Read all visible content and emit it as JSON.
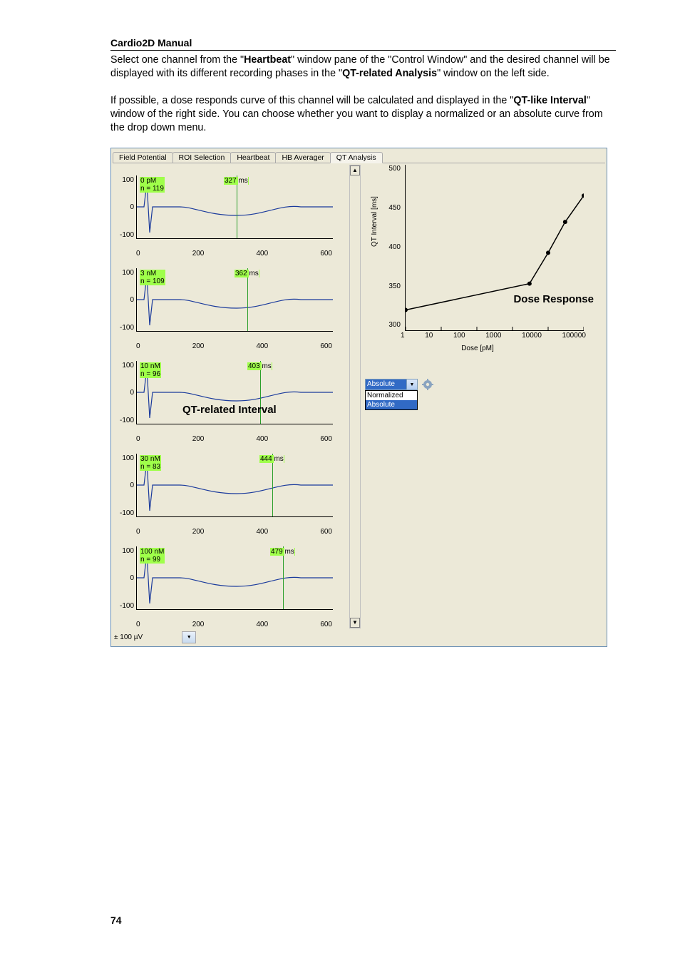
{
  "header": {
    "title": "Cardio2D Manual"
  },
  "para1": {
    "t1": "Select one channel from the \"",
    "heartbeat": "Heartbeat",
    "t2": "\" window pane of the \"Control Window\" and the desired channel will be displayed with its different recording phases in the \"",
    "qtrel": "QT-related Analysis",
    "t3": "\" window on the left side."
  },
  "para2": {
    "t1": "If possible, a dose responds curve of this channel will be calculated and displayed in the \"",
    "qtlike": "QT-like Interval",
    "t2": "\" window of the right side. You can choose whether you want to display a normalized or an absolute curve from the drop down menu."
  },
  "tabs": [
    "Field Potential",
    "ROI Selection",
    "Heartbeat",
    "HB Averager",
    "QT Analysis"
  ],
  "active_tab": 4,
  "yticks": [
    "100",
    "0",
    "-100"
  ],
  "xticks": [
    "0",
    "200",
    "400",
    "600"
  ],
  "unitbar": {
    "label": "± 100 µV"
  },
  "overlay_left": "QT-related Interval",
  "chart_data": {
    "left_panels": [
      {
        "dose": "0 pM",
        "n": "n = 119",
        "ms": 327,
        "ms_x_frac": 0.51
      },
      {
        "dose": "3 nM",
        "n": "n = 109",
        "ms": 362,
        "ms_x_frac": 0.565
      },
      {
        "dose": "10 nM",
        "n": "n = 96",
        "ms": 403,
        "ms_x_frac": 0.63
      },
      {
        "dose": "30 nM",
        "n": "n = 83",
        "ms": 444,
        "ms_x_frac": 0.69
      },
      {
        "dose": "100 nM",
        "n": "n = 99",
        "ms": 479,
        "ms_x_frac": 0.745
      }
    ],
    "dose_response": {
      "type": "line",
      "title": "Dose Response",
      "xlabel": "Dose [pM]",
      "ylabel": "QT Interval [ms]",
      "xscale": "log",
      "xlim": [
        1,
        100000
      ],
      "ylim": [
        300,
        520
      ],
      "xticks": [
        1,
        10,
        100,
        1000,
        10000,
        100000
      ],
      "yticks": [
        300,
        350,
        400,
        450,
        500
      ],
      "series": [
        {
          "name": "QT Interval",
          "x": [
            1,
            3000,
            10000,
            30000,
            100000
          ],
          "y": [
            327,
            362,
            403,
            444,
            479
          ]
        }
      ]
    }
  },
  "combo": {
    "selected": "Absolute",
    "options": [
      "Normalized",
      "Absolute"
    ]
  },
  "pagenum": "74"
}
